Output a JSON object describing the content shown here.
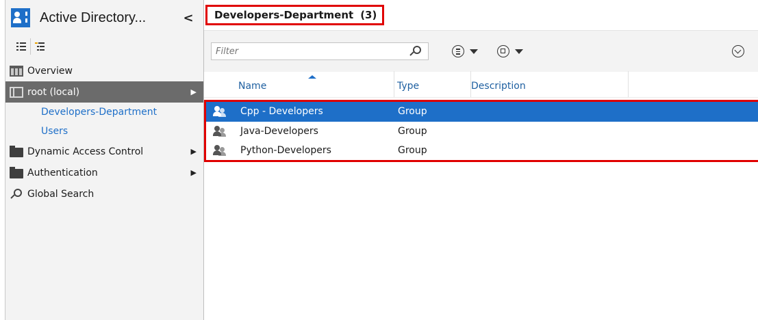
{
  "sidebar": {
    "app_title": "Active Directory...",
    "collapse_glyph": "<",
    "nav": {
      "overview": "Overview",
      "root": "root (local)",
      "children": [
        "Developers-Department",
        "Users"
      ],
      "dynamic_access_control": "Dynamic Access Control",
      "authentication": "Authentication",
      "global_search": "Global Search"
    }
  },
  "main": {
    "title": "Developers-Department",
    "count": "(3)",
    "filter_placeholder": "Filter",
    "columns": {
      "name": "Name",
      "type": "Type",
      "description": "Description"
    },
    "rows": [
      {
        "name": "Cpp - Developers",
        "type": "Group",
        "selected": true
      },
      {
        "name": "Java-Developers",
        "type": "Group",
        "selected": false
      },
      {
        "name": "Python-Developers",
        "type": "Group",
        "selected": false
      }
    ]
  },
  "colors": {
    "accent": "#1e6fc8",
    "highlight_box": "#e00000",
    "selected_nav": "#6b6b6b"
  }
}
